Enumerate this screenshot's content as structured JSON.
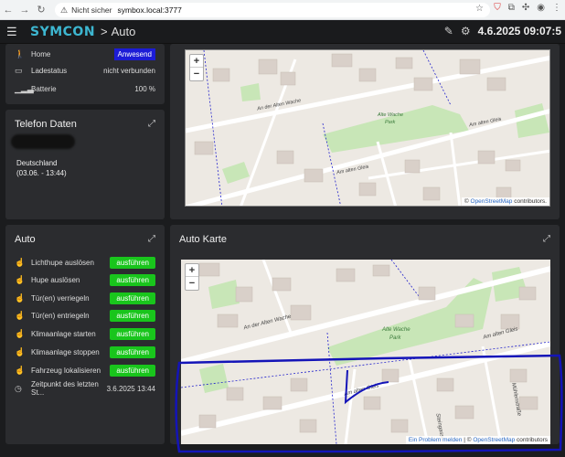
{
  "browser": {
    "warning": "Nicht sicher",
    "url": "symbox.local:3777"
  },
  "header": {
    "logo": "SYMCON",
    "breadcrumb_sep": ">",
    "breadcrumb": "Auto",
    "datetime": "4.6.2025 09:07:5"
  },
  "status_panel": {
    "rows": [
      {
        "icon": "walking-icon",
        "label": "Home",
        "value": "Anwesend"
      },
      {
        "icon": "battery-icon",
        "label": "Ladestatus",
        "value": "nicht verbunden"
      },
      {
        "icon": "signal-icon",
        "label": "Batterie",
        "value": "100 %"
      }
    ]
  },
  "telefon_panel": {
    "title": "Telefon Daten",
    "location": "Deutschland",
    "timestamp": "(03.06. - 13:44)"
  },
  "auto_panel": {
    "title": "Auto",
    "actions": [
      {
        "label": "Lichthupe auslösen",
        "button": "ausführen"
      },
      {
        "label": "Hupe auslösen",
        "button": "ausführen"
      },
      {
        "label": "Tür(en) verriegeln",
        "button": "ausführen"
      },
      {
        "label": "Tür(en) entriegeln",
        "button": "ausführen"
      },
      {
        "label": "Klimaanlage starten",
        "button": "ausführen"
      },
      {
        "label": "Klimaanlage stoppen",
        "button": "ausführen"
      },
      {
        "label": "Fahrzeug lokalisieren",
        "button": "ausführen"
      }
    ],
    "last_label": "Zeitpunkt des letzten St...",
    "last_value": "3.6.2025 13:44"
  },
  "top_map": {
    "zoom_in": "+",
    "zoom_out": "−",
    "attribution_prefix": "©",
    "attribution_link": "OpenStreetMap",
    "attribution_suffix": "contributors."
  },
  "auto_map": {
    "title": "Auto Karte",
    "zoom_in": "+",
    "zoom_out": "−",
    "attribution_link1": "Ein Problem melden",
    "attribution_sep": "|",
    "attribution_prefix": "©",
    "attribution_link2": "OpenStreetMap",
    "attribution_suffix": "contributors"
  },
  "map_labels": {
    "street1": "An der Alten Wache",
    "street2": "Am alten Gleis",
    "park": "Alte Wache",
    "park2": "Park",
    "street3": "Am alten Gleis",
    "street4": "Am alten Gleis",
    "street5": "Am alten Gleis",
    "street6": "Steingasse",
    "street7": "Mühlenstraße"
  },
  "colors": {
    "accent_logo": "#3db6d0",
    "badge_blue": "#1c1cd6",
    "button_green": "#19c51c",
    "annotation_blue": "#1414b8"
  }
}
